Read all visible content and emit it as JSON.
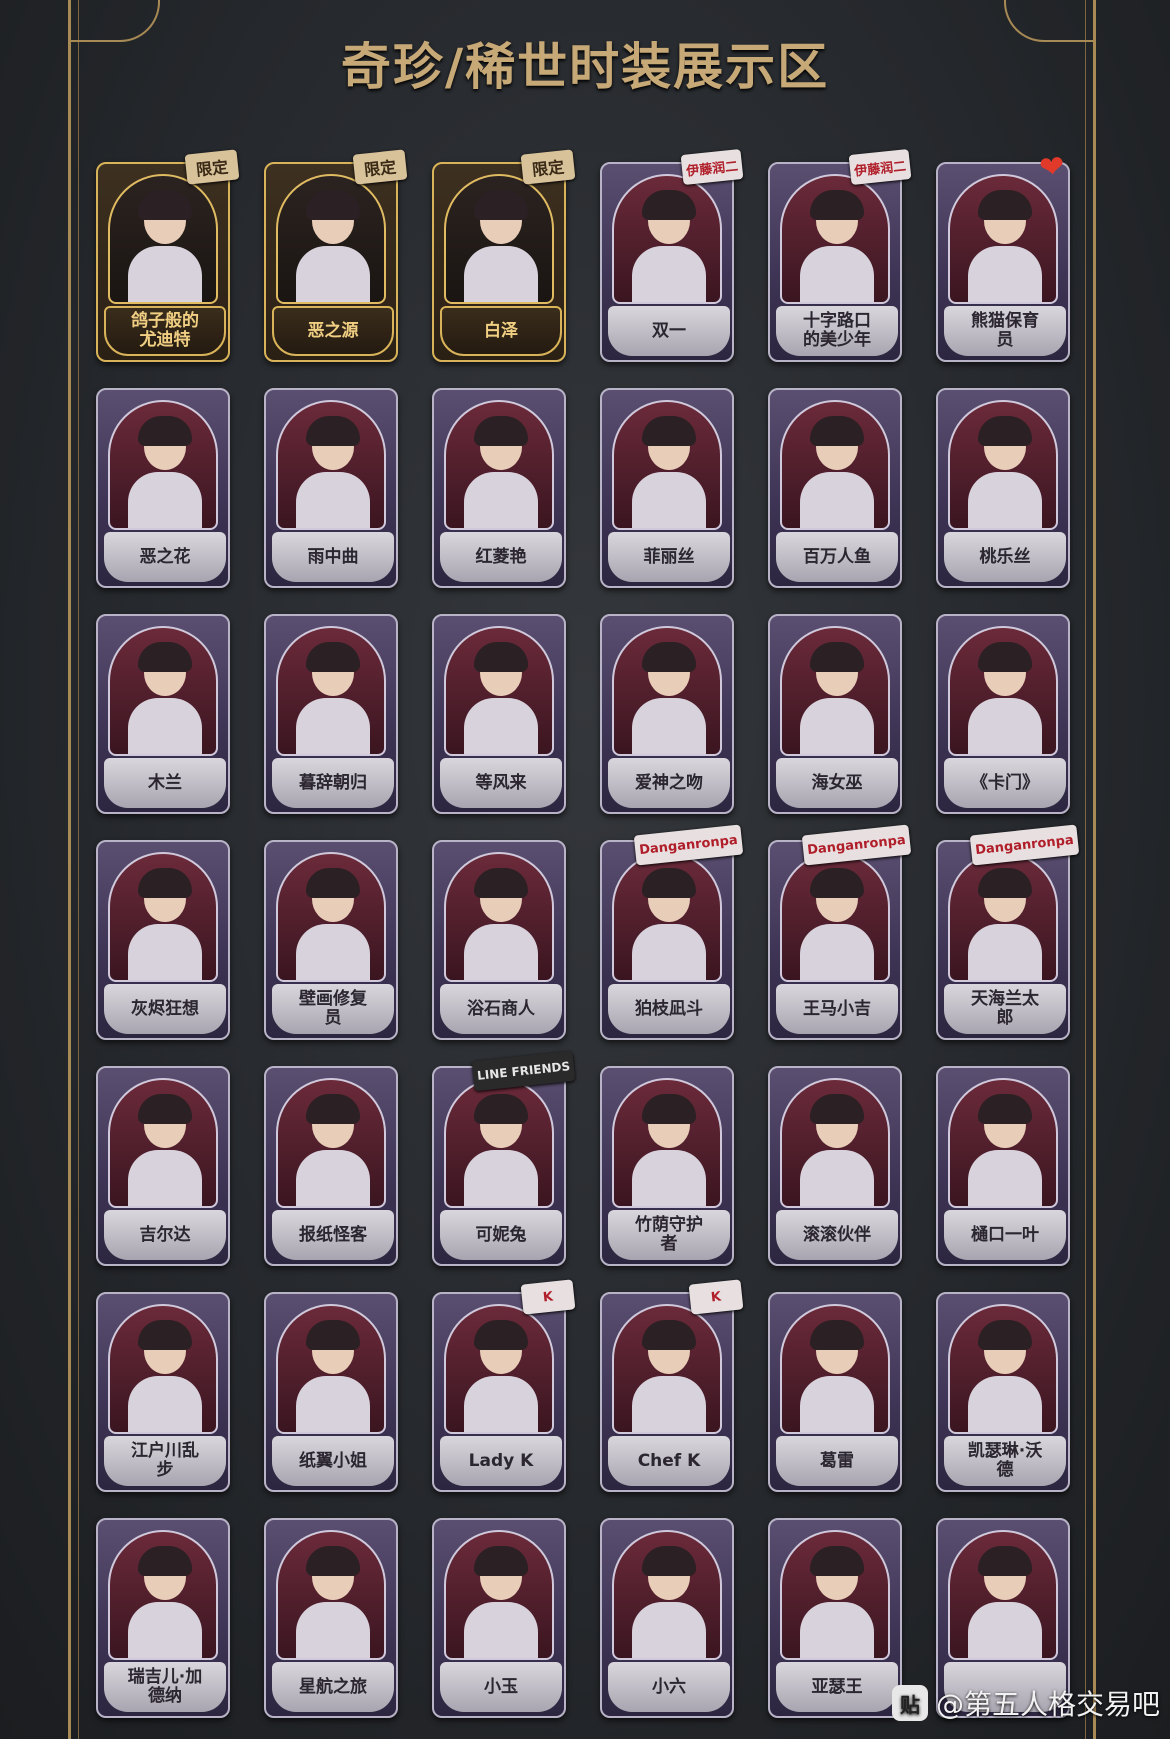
{
  "header": {
    "title": "奇珍/稀世时装展示区"
  },
  "cards": [
    {
      "name": "鸽子般的\n尤迪特",
      "tag": "限定",
      "style": "gold",
      "tagStyle": ""
    },
    {
      "name": "恶之源",
      "tag": "限定",
      "style": "gold",
      "tagStyle": ""
    },
    {
      "name": "白泽",
      "tag": "限定",
      "style": "gold",
      "tagStyle": ""
    },
    {
      "name": "双一",
      "tag": "伊藤润二",
      "style": "purple",
      "tagStyle": "red"
    },
    {
      "name": "十字路口\n的美少年",
      "tag": "伊藤润二",
      "style": "purple",
      "tagStyle": "red"
    },
    {
      "name": "熊猫保育\n员",
      "tag": "❤",
      "style": "purple",
      "tagStyle": "heart"
    },
    {
      "name": "恶之花",
      "tag": "",
      "style": "purple",
      "tagStyle": ""
    },
    {
      "name": "雨中曲",
      "tag": "",
      "style": "purple",
      "tagStyle": ""
    },
    {
      "name": "红菱艳",
      "tag": "",
      "style": "purple",
      "tagStyle": ""
    },
    {
      "name": "菲丽丝",
      "tag": "",
      "style": "purple",
      "tagStyle": ""
    },
    {
      "name": "百万人鱼",
      "tag": "",
      "style": "purple",
      "tagStyle": ""
    },
    {
      "name": "桃乐丝",
      "tag": "",
      "style": "purple",
      "tagStyle": ""
    },
    {
      "name": "木兰",
      "tag": "",
      "style": "purple",
      "tagStyle": ""
    },
    {
      "name": "暮辞朝归",
      "tag": "",
      "style": "purple",
      "tagStyle": ""
    },
    {
      "name": "等风来",
      "tag": "",
      "style": "purple",
      "tagStyle": ""
    },
    {
      "name": "爱神之吻",
      "tag": "",
      "style": "purple",
      "tagStyle": ""
    },
    {
      "name": "海女巫",
      "tag": "",
      "style": "purple",
      "tagStyle": ""
    },
    {
      "name": "《卡门》",
      "tag": "",
      "style": "purple",
      "tagStyle": ""
    },
    {
      "name": "灰烬狂想",
      "tag": "",
      "style": "purple",
      "tagStyle": ""
    },
    {
      "name": "壁画修复\n员",
      "tag": "",
      "style": "purple",
      "tagStyle": ""
    },
    {
      "name": "浴石商人",
      "tag": "",
      "style": "purple",
      "tagStyle": ""
    },
    {
      "name": "狛枝凪斗",
      "tag": "Danganronpa",
      "style": "purple",
      "tagStyle": "red"
    },
    {
      "name": "王马小吉",
      "tag": "Danganronpa",
      "style": "purple",
      "tagStyle": "red"
    },
    {
      "name": "天海兰太\n郎",
      "tag": "Danganronpa",
      "style": "purple",
      "tagStyle": "red"
    },
    {
      "name": "吉尔达",
      "tag": "",
      "style": "purple",
      "tagStyle": ""
    },
    {
      "name": "报纸怪客",
      "tag": "",
      "style": "purple",
      "tagStyle": ""
    },
    {
      "name": "可妮兔",
      "tag": "LINE FRIENDS",
      "style": "purple",
      "tagStyle": "dark"
    },
    {
      "name": "竹荫守护\n者",
      "tag": "",
      "style": "purple",
      "tagStyle": ""
    },
    {
      "name": "滚滚伙伴",
      "tag": "",
      "style": "purple",
      "tagStyle": ""
    },
    {
      "name": "樋口一叶",
      "tag": "",
      "style": "purple",
      "tagStyle": ""
    },
    {
      "name": "江户川乱\n步",
      "tag": "",
      "style": "purple",
      "tagStyle": ""
    },
    {
      "name": "纸翼小姐",
      "tag": "",
      "style": "purple",
      "tagStyle": ""
    },
    {
      "name": "Lady K",
      "tag": "K",
      "style": "purple",
      "tagStyle": "red"
    },
    {
      "name": "Chef K",
      "tag": "K",
      "style": "purple",
      "tagStyle": "red"
    },
    {
      "name": "葛雷",
      "tag": "",
      "style": "purple",
      "tagStyle": ""
    },
    {
      "name": "凯瑟琳·沃\n德",
      "tag": "",
      "style": "purple",
      "tagStyle": ""
    },
    {
      "name": "瑞吉儿·加\n德纳",
      "tag": "",
      "style": "purple",
      "tagStyle": ""
    },
    {
      "name": "星航之旅",
      "tag": "",
      "style": "purple",
      "tagStyle": ""
    },
    {
      "name": "小玉",
      "tag": "",
      "style": "purple",
      "tagStyle": ""
    },
    {
      "name": "小六",
      "tag": "",
      "style": "purple",
      "tagStyle": ""
    },
    {
      "name": "亚瑟王",
      "tag": "",
      "style": "purple",
      "tagStyle": ""
    },
    {
      "name": "",
      "tag": "",
      "style": "purple",
      "tagStyle": ""
    }
  ],
  "watermark": {
    "text": "@第五人格交易吧",
    "logo": "贴"
  },
  "colors": {
    "gold": "#d9b35a",
    "purple": "#3f3556",
    "background": "#26292d"
  }
}
